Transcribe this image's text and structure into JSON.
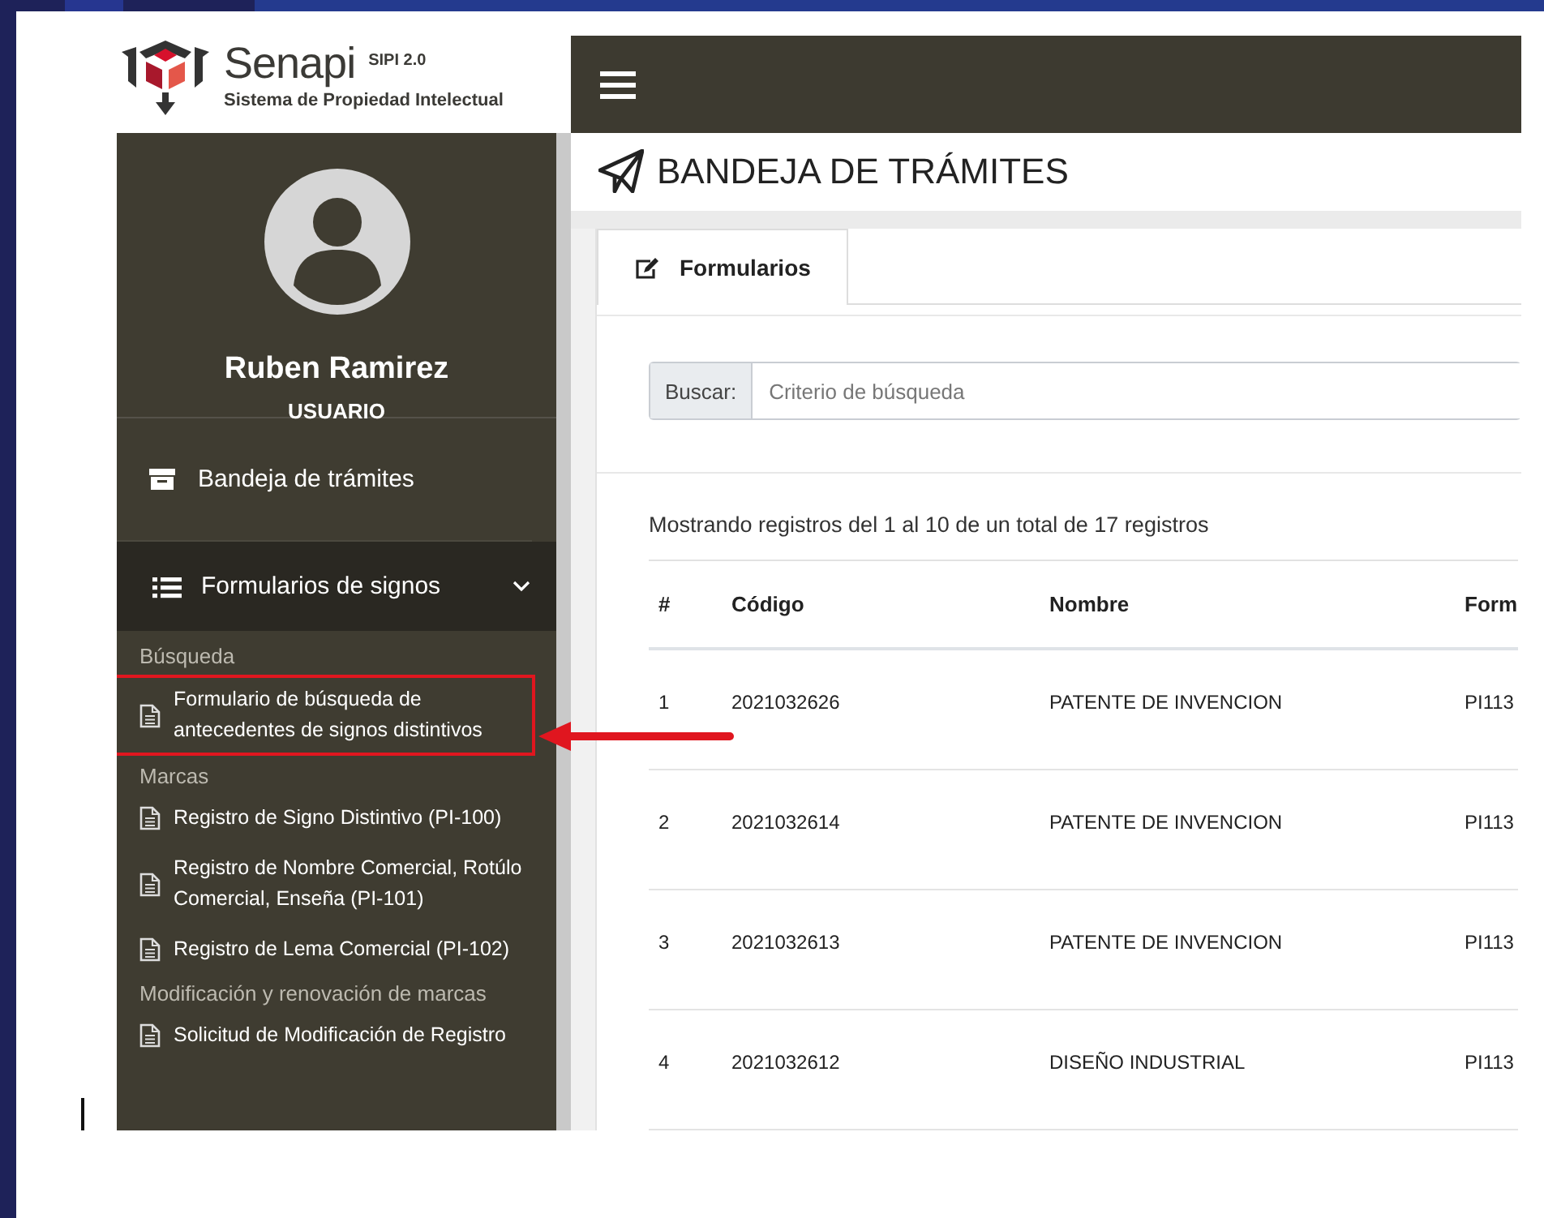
{
  "logo": {
    "name": "Senapi",
    "version": "SIPI 2.0",
    "subtitle": "Sistema de Propiedad Intelectual"
  },
  "user": {
    "name": "Ruben Ramirez",
    "role": "USUARIO"
  },
  "sidebar": {
    "items": [
      {
        "kind": "link",
        "label": "Bandeja de trámites"
      },
      {
        "kind": "group",
        "label": "Formularios de signos",
        "expanded": true,
        "children": [
          {
            "kind": "heading",
            "label": "Búsqueda"
          },
          {
            "kind": "form",
            "label": "Formulario de búsqueda de antecedentes de signos distintivos",
            "highlighted": true
          },
          {
            "kind": "heading",
            "label": "Marcas"
          },
          {
            "kind": "form",
            "label": "Registro de Signo Distintivo (PI-100)",
            "highlighted": false
          },
          {
            "kind": "form",
            "label": "Registro de Nombre Comercial, Rotúlo Comercial, Enseña (PI-101)",
            "highlighted": false
          },
          {
            "kind": "form",
            "label": "Registro de Lema Comercial (PI-102)",
            "highlighted": false
          },
          {
            "kind": "heading",
            "label": "Modificación y renovación de marcas"
          },
          {
            "kind": "form",
            "label": "Solicitud de Modificación de Registro",
            "highlighted": false
          }
        ]
      }
    ]
  },
  "page_title": "BANDEJA DE TRÁMITES",
  "tabs": [
    {
      "label": "Formularios",
      "selected": true
    }
  ],
  "search": {
    "label": "Buscar:",
    "placeholder": "Criterio de búsqueda"
  },
  "info": "Mostrando registros del 1 al 10 de un total de 17 registros",
  "table": {
    "columns": [
      "#",
      "Código",
      "Nombre",
      "Form"
    ],
    "rows": [
      [
        "1",
        "2021032626",
        "PATENTE DE INVENCION",
        "PI113"
      ],
      [
        "2",
        "2021032614",
        "PATENTE DE INVENCION",
        "PI113"
      ],
      [
        "3",
        "2021032613",
        "PATENTE DE INVENCION",
        "PI113"
      ],
      [
        "4",
        "2021032612",
        "DISEÑO INDUSTRIAL",
        "PI113"
      ]
    ]
  }
}
